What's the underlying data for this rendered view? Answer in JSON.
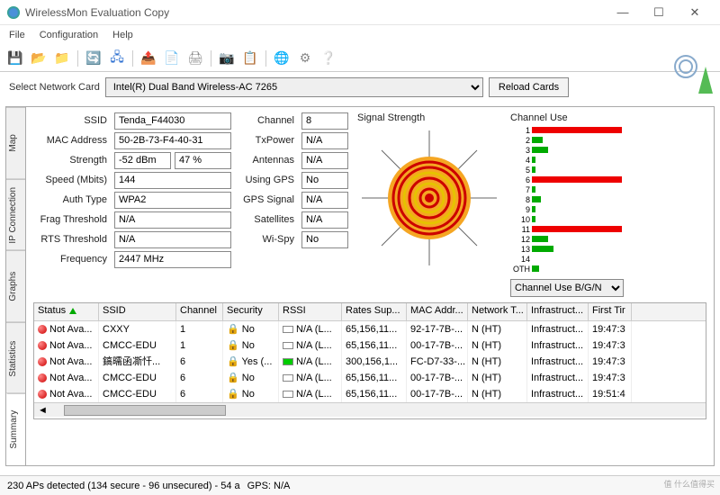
{
  "window": {
    "title": "WirelessMon Evaluation Copy"
  },
  "menu": {
    "file": "File",
    "config": "Configuration",
    "help": "Help"
  },
  "card": {
    "label": "Select Network Card",
    "value": "Intel(R) Dual Band Wireless-AC 7265",
    "reload": "Reload Cards"
  },
  "tabs": {
    "summary": "Summary",
    "statistics": "Statistics",
    "graphs": "Graphs",
    "ip": "IP Connection",
    "map": "Map"
  },
  "fields": {
    "ssid_l": "SSID",
    "ssid": "Tenda_F44030",
    "mac_l": "MAC Address",
    "mac": "50-2B-73-F4-40-31",
    "strength_l": "Strength",
    "strength_db": "-52 dBm",
    "strength_pct": "47 %",
    "speed_l": "Speed (Mbits)",
    "speed": "144",
    "auth_l": "Auth Type",
    "auth": "WPA2",
    "frag_l": "Frag Threshold",
    "frag": "N/A",
    "rts_l": "RTS Threshold",
    "rts": "N/A",
    "freq_l": "Frequency",
    "freq": "2447 MHz",
    "chan_l": "Channel",
    "chan": "8",
    "txp_l": "TxPower",
    "txp": "N/A",
    "ant_l": "Antennas",
    "ant": "N/A",
    "gps_l": "Using GPS",
    "gps": "No",
    "gpss_l": "GPS Signal",
    "gpss": "N/A",
    "sat_l": "Satellites",
    "sat": "N/A",
    "wispy_l": "Wi-Spy",
    "wispy": "No"
  },
  "signal_title": "Signal Strength",
  "channel_title": "Channel Use",
  "channel_select": "Channel Use B/G/N",
  "channel_bars": [
    {
      "n": "1",
      "w": 100,
      "c": "#e00"
    },
    {
      "n": "2",
      "w": 12,
      "c": "#0a0"
    },
    {
      "n": "3",
      "w": 18,
      "c": "#0a0"
    },
    {
      "n": "4",
      "w": 4,
      "c": "#0a0"
    },
    {
      "n": "5",
      "w": 4,
      "c": "#0a0"
    },
    {
      "n": "6",
      "w": 100,
      "c": "#e00"
    },
    {
      "n": "7",
      "w": 4,
      "c": "#0a0"
    },
    {
      "n": "8",
      "w": 10,
      "c": "#0a0"
    },
    {
      "n": "9",
      "w": 4,
      "c": "#0a0"
    },
    {
      "n": "10",
      "w": 4,
      "c": "#0a0"
    },
    {
      "n": "11",
      "w": 100,
      "c": "#e00"
    },
    {
      "n": "12",
      "w": 18,
      "c": "#0a0"
    },
    {
      "n": "13",
      "w": 24,
      "c": "#0a0"
    },
    {
      "n": "14",
      "w": 0,
      "c": "#0a0"
    },
    {
      "n": "OTH",
      "w": 8,
      "c": "#0a0"
    }
  ],
  "grid": {
    "headers": [
      "Status",
      "SSID",
      "Channel",
      "Security",
      "RSSI",
      "Rates Sup...",
      "MAC Addr...",
      "Network T...",
      "Infrastruct...",
      "First Tir"
    ],
    "rows": [
      {
        "status": "Not Ava...",
        "ssid": "CXXY",
        "ch": "1",
        "sec": "No",
        "rssi": "N/A (L...",
        "rates": "65,156,11...",
        "mac": "92-17-7B-...",
        "net": "N (HT)",
        "infra": "Infrastruct...",
        "time": "19:47:3",
        "rc": ""
      },
      {
        "status": "Not Ava...",
        "ssid": "CMCC-EDU",
        "ch": "1",
        "sec": "No",
        "rssi": "N/A (L...",
        "rates": "65,156,11...",
        "mac": "00-17-7B-...",
        "net": "N (HT)",
        "infra": "Infrastruct...",
        "time": "19:47:3",
        "rc": ""
      },
      {
        "status": "Not Ava...",
        "ssid": "鎬曘函凘忏...",
        "ch": "6",
        "sec": "Yes (...",
        "rssi": "N/A (L...",
        "rates": "300,156,1...",
        "mac": "FC-D7-33-...",
        "net": "N (HT)",
        "infra": "Infrastruct...",
        "time": "19:47:3",
        "rc": "#0c0"
      },
      {
        "status": "Not Ava...",
        "ssid": "CMCC-EDU",
        "ch": "6",
        "sec": "No",
        "rssi": "N/A (L...",
        "rates": "65,156,11...",
        "mac": "00-17-7B-...",
        "net": "N (HT)",
        "infra": "Infrastruct...",
        "time": "19:47:3",
        "rc": ""
      },
      {
        "status": "Not Ava...",
        "ssid": "CMCC-EDU",
        "ch": "6",
        "sec": "No",
        "rssi": "N/A (L...",
        "rates": "65,156,11...",
        "mac": "00-17-7B-...",
        "net": "N (HT)",
        "infra": "Infrastruct...",
        "time": "19:51:4",
        "rc": ""
      }
    ]
  },
  "status": {
    "aps": "230 APs detected (134 secure - 96 unsecured) - 54 a",
    "gps": "GPS: N/A"
  },
  "watermark": "值   什么值得买"
}
